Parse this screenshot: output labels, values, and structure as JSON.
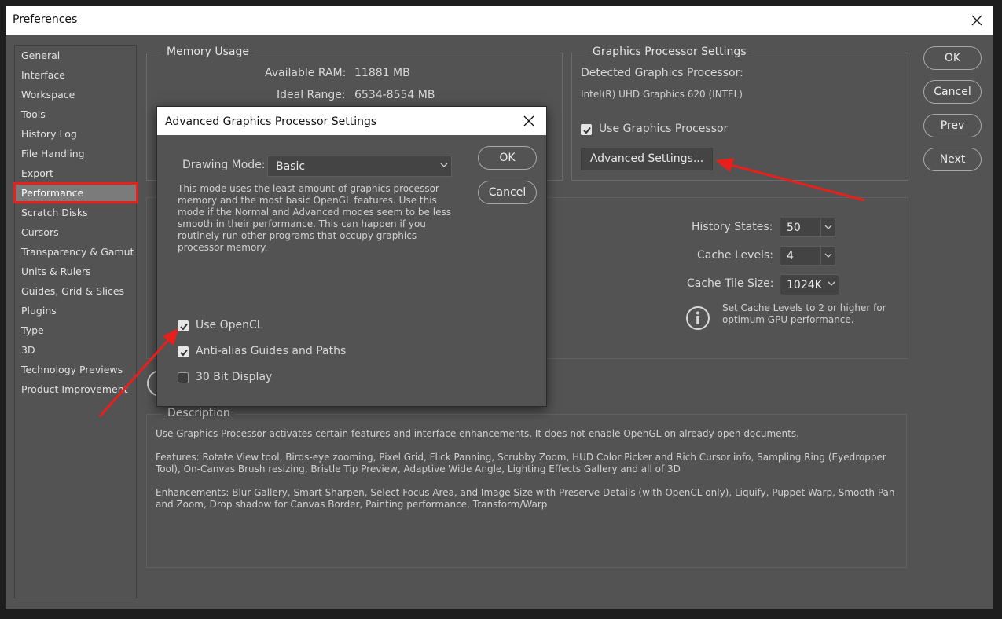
{
  "window": {
    "title": "Preferences"
  },
  "sidebar": {
    "items": [
      {
        "label": "General"
      },
      {
        "label": "Interface"
      },
      {
        "label": "Workspace"
      },
      {
        "label": "Tools"
      },
      {
        "label": "History Log"
      },
      {
        "label": "File Handling"
      },
      {
        "label": "Export"
      },
      {
        "label": "Performance",
        "selected": true
      },
      {
        "label": "Scratch Disks"
      },
      {
        "label": "Cursors"
      },
      {
        "label": "Transparency & Gamut"
      },
      {
        "label": "Units & Rulers"
      },
      {
        "label": "Guides, Grid & Slices"
      },
      {
        "label": "Plugins"
      },
      {
        "label": "Type"
      },
      {
        "label": "3D"
      },
      {
        "label": "Technology Previews"
      },
      {
        "label": "Product Improvement"
      }
    ]
  },
  "memory": {
    "title": "Memory Usage",
    "available_label": "Available RAM:",
    "available_value": "11881 MB",
    "ideal_label": "Ideal Range:",
    "ideal_value": "6534-8554 MB"
  },
  "gpu": {
    "title": "Graphics Processor Settings",
    "detected_label": "Detected Graphics Processor:",
    "detected_value": "Intel(R) UHD Graphics 620 (INTEL)",
    "use_gpu_label": "Use Graphics Processor",
    "use_gpu_checked": true,
    "advanced_button": "Advanced Settings..."
  },
  "buttons": {
    "ok": "OK",
    "cancel": "Cancel",
    "prev": "Prev",
    "next": "Next"
  },
  "history": {
    "history_states_label": "History States:",
    "history_states_value": "50",
    "cache_levels_label": "Cache Levels:",
    "cache_levels_value": "4",
    "cache_tile_label": "Cache Tile Size:",
    "cache_tile_value": "1024K",
    "info_text": "Set Cache Levels to 2 or higher for optimum GPU performance."
  },
  "description": {
    "title": "Description",
    "p1": "Use Graphics Processor activates certain features and interface enhancements. It does not enable OpenGL on already open documents.",
    "p2": "Features: Rotate View tool, Birds-eye zooming, Pixel Grid, Flick Panning, Scrubby Zoom, HUD Color Picker and Rich Cursor info, Sampling Ring (Eyedropper Tool), On-Canvas Brush resizing, Bristle Tip Preview, Adaptive Wide Angle, Lighting Effects Gallery and all of 3D",
    "p3": "Enhancements: Blur Gallery, Smart Sharpen, Select Focus Area, and Image Size with Preserve Details (with OpenCL only), Liquify, Puppet Warp, Smooth Pan and Zoom, Drop shadow for Canvas Border, Painting performance, Transform/Warp"
  },
  "dialog": {
    "title": "Advanced Graphics Processor Settings",
    "drawing_mode_label": "Drawing Mode:",
    "drawing_mode_value": "Basic",
    "mode_description": "This mode uses the least amount of graphics processor memory and the most basic OpenGL features.  Use this mode if the Normal and Advanced modes seem to be less smooth in their performance.  This can happen if you routinely run other programs that occupy graphics processor memory.",
    "ok": "OK",
    "cancel": "Cancel",
    "checkboxes": [
      {
        "label": "Use OpenCL",
        "checked": true
      },
      {
        "label": "Anti-alias Guides and Paths",
        "checked": true
      },
      {
        "label": "30 Bit Display",
        "checked": false
      }
    ]
  },
  "colors": {
    "window_bg": "#535353",
    "titlebar_bg": "#ffffff",
    "annotation_red": "#e8201c",
    "selected_item_bg": "#7b7b7b"
  }
}
